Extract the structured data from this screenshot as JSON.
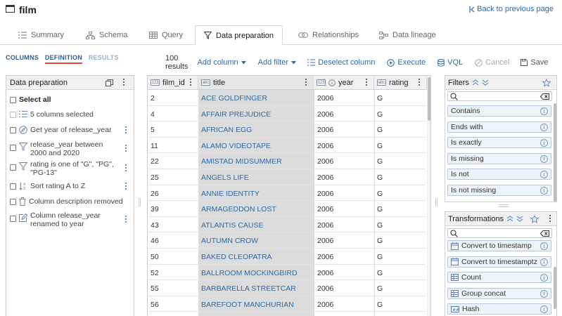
{
  "app": {
    "title": "film",
    "back_link": "Back to previous page"
  },
  "tabs": [
    {
      "label": "Summary",
      "icon": "list-icon"
    },
    {
      "label": "Schema",
      "icon": "schema-icon"
    },
    {
      "label": "Query",
      "icon": "grid-icon"
    },
    {
      "label": "Data preparation",
      "icon": "filter-icon",
      "active": true
    },
    {
      "label": "Relationships",
      "icon": "link-icon"
    },
    {
      "label": "Data lineage",
      "icon": "lineage-icon"
    }
  ],
  "subtabs": {
    "columns": "COLUMNS",
    "definition": "DEFINITION",
    "results": "RESULTS"
  },
  "toolbar": {
    "count": "100 results",
    "add_column": "Add column",
    "add_filter": "Add filter",
    "deselect": "Deselect column",
    "execute": "Execute",
    "vql": "VQL",
    "cancel": "Cancel",
    "save": "Save",
    "help": "?"
  },
  "left_panel": {
    "title": "Data preparation",
    "select_all": "Select all",
    "steps": [
      {
        "label": "5 columns selected",
        "icon": "columns-list-icon"
      },
      {
        "label": "Get year of release_year",
        "icon": "compass-icon"
      },
      {
        "label": "release_year between 2000 and 2020",
        "icon": "funnel-icon"
      },
      {
        "label": "rating is one of \"G\", \"PG\", \"PG-13\"",
        "icon": "funnel-icon"
      },
      {
        "label": "Sort rating A to Z",
        "icon": "sort-az-icon"
      },
      {
        "label": "Column description removed",
        "icon": "trash-icon"
      },
      {
        "label": "Column release_year renamed to year",
        "icon": "edit-icon"
      }
    ]
  },
  "grid": {
    "columns": [
      {
        "name": "film_id",
        "type_icon": "number-type-icon"
      },
      {
        "name": "title",
        "type_icon": "text-type-icon"
      },
      {
        "name": "year",
        "type_icon": "number-type-icon"
      },
      {
        "name": "rating",
        "type_icon": "text-type-icon"
      }
    ],
    "rows": [
      [
        "2",
        "ACE GOLDFINGER",
        "2006",
        "G"
      ],
      [
        "4",
        "AFFAIR PREJUDICE",
        "2006",
        "G"
      ],
      [
        "5",
        "AFRICAN EGG",
        "2006",
        "G"
      ],
      [
        "11",
        "ALAMO VIDEOTAPE",
        "2006",
        "G"
      ],
      [
        "22",
        "AMISTAD MIDSUMMER",
        "2006",
        "G"
      ],
      [
        "25",
        "ANGELS LIFE",
        "2006",
        "G"
      ],
      [
        "26",
        "ANNIE IDENTITY",
        "2006",
        "G"
      ],
      [
        "39",
        "ARMAGEDDON LOST",
        "2006",
        "G"
      ],
      [
        "43",
        "ATLANTIS CAUSE",
        "2006",
        "G"
      ],
      [
        "46",
        "AUTUMN CROW",
        "2006",
        "G"
      ],
      [
        "50",
        "BAKED CLEOPATRA",
        "2006",
        "G"
      ],
      [
        "52",
        "BALLROOM MOCKINGBIRD",
        "2006",
        "G"
      ],
      [
        "55",
        "BARBARELLA STREETCAR",
        "2006",
        "G"
      ],
      [
        "56",
        "BAREFOOT MANCHURIAN",
        "2006",
        "G"
      ],
      [
        "",
        "",
        "2006",
        "G"
      ]
    ]
  },
  "filters_panel": {
    "title": "Filters",
    "items": [
      "Contains",
      "Ends with",
      "Is exactly",
      "Is missing",
      "Is not",
      "Is not missing"
    ]
  },
  "transformations_panel": {
    "title": "Transformations",
    "items": [
      {
        "label": "Convert to timestamp",
        "icon": "calendar-icon"
      },
      {
        "label": "Convert to timestamptz",
        "icon": "calendar-icon"
      },
      {
        "label": "Count",
        "icon": "table-icon"
      },
      {
        "label": "Group concat",
        "icon": "table-icon"
      },
      {
        "label": "Hash",
        "icon": "hash-icon"
      }
    ]
  },
  "colors": {
    "accent": "#2d6aa8",
    "active_underline": "#d84b3c",
    "selected_column_bg": "#dcdcdc"
  }
}
